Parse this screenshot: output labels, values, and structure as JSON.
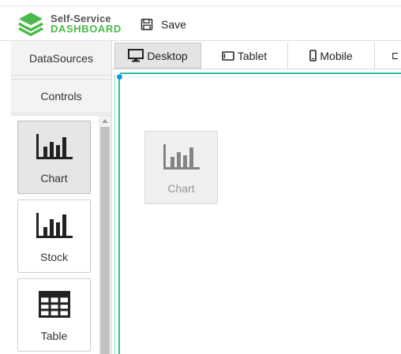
{
  "header": {
    "logo_line1": "Self-Service",
    "logo_line2": "DASHBOARD",
    "save_label": "Save"
  },
  "left_panel": {
    "tabs": [
      {
        "label": "DataSources",
        "icon": "none"
      },
      {
        "label": "Controls",
        "icon": "none"
      }
    ],
    "controls": [
      {
        "label": "Chart",
        "icon": "bar-chart-icon",
        "selected": true
      },
      {
        "label": "Stock",
        "icon": "stock-chart-icon",
        "selected": false
      },
      {
        "label": "Table",
        "icon": "table-icon",
        "selected": false
      }
    ]
  },
  "device_tabs": [
    {
      "label": "Desktop",
      "icon": "desktop-icon",
      "active": true
    },
    {
      "label": "Tablet",
      "icon": "tablet-icon",
      "active": false
    },
    {
      "label": "Mobile",
      "icon": "mobile-icon",
      "active": false
    }
  ],
  "canvas": {
    "dragged_item_label": "Chart",
    "dragged_item_icon": "bar-chart-icon"
  },
  "colors": {
    "brand_green": "#4ab84a",
    "guide_teal": "#2fbfa0",
    "guide_dot_blue": "#1a9bd7"
  }
}
